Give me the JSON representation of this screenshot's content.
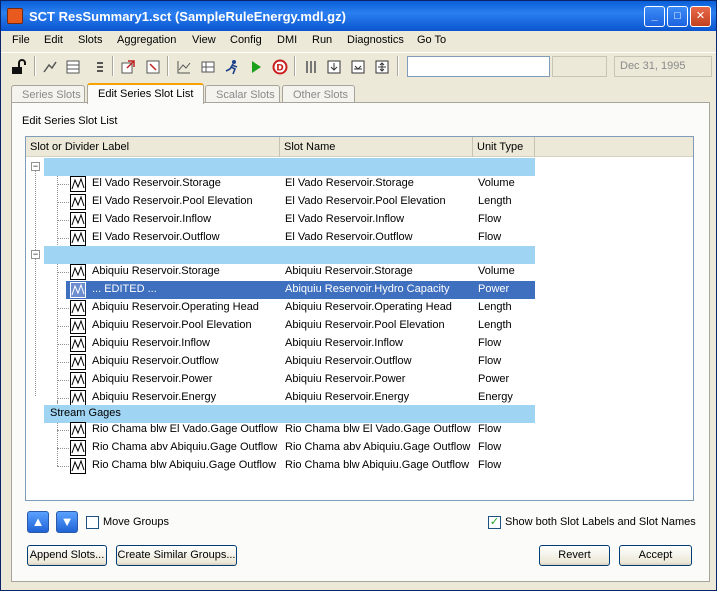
{
  "window": {
    "title": "SCT ResSummary1.sct (SampleRuleEnergy.mdl.gz)"
  },
  "menu": [
    "File",
    "Edit",
    "Slots",
    "Aggregation",
    "View",
    "Config",
    "DMI",
    "Run",
    "Diagnostics",
    "Go To"
  ],
  "toolbar": {
    "search_value": "",
    "date": "Dec 31, 1995"
  },
  "tabs": [
    {
      "label": "Series Slots",
      "active": false
    },
    {
      "label": "Edit Series Slot List",
      "active": true
    },
    {
      "label": "Scalar Slots",
      "active": false
    },
    {
      "label": "Other Slots",
      "active": false
    }
  ],
  "panel": {
    "heading": "Edit Series Slot List"
  },
  "table": {
    "columns": [
      "Slot or Divider Label",
      "Slot Name",
      "Unit Type"
    ],
    "rows": [
      {
        "kind": "divider",
        "label": ""
      },
      {
        "kind": "slot",
        "label": "El Vado Reservoir.Storage",
        "slot": "El Vado Reservoir.Storage",
        "unit": "Volume"
      },
      {
        "kind": "slot",
        "label": "El Vado Reservoir.Pool Elevation",
        "slot": "El Vado Reservoir.Pool Elevation",
        "unit": "Length"
      },
      {
        "kind": "slot",
        "label": "El Vado Reservoir.Inflow",
        "slot": "El Vado Reservoir.Inflow",
        "unit": "Flow"
      },
      {
        "kind": "slot",
        "label": "El Vado Reservoir.Outflow",
        "slot": "El Vado Reservoir.Outflow",
        "unit": "Flow"
      },
      {
        "kind": "divider",
        "label": ""
      },
      {
        "kind": "slot",
        "label": "Abiquiu Reservoir.Storage",
        "slot": "Abiquiu Reservoir.Storage",
        "unit": "Volume"
      },
      {
        "kind": "slot",
        "label": "... EDITED ...",
        "slot": "Abiquiu Reservoir.Hydro Capacity",
        "unit": "Power",
        "selected": true
      },
      {
        "kind": "slot",
        "label": "Abiquiu Reservoir.Operating Head",
        "slot": "Abiquiu Reservoir.Operating Head",
        "unit": "Length"
      },
      {
        "kind": "slot",
        "label": "Abiquiu Reservoir.Pool Elevation",
        "slot": "Abiquiu Reservoir.Pool Elevation",
        "unit": "Length"
      },
      {
        "kind": "slot",
        "label": "Abiquiu Reservoir.Inflow",
        "slot": "Abiquiu Reservoir.Inflow",
        "unit": "Flow"
      },
      {
        "kind": "slot",
        "label": "Abiquiu Reservoir.Outflow",
        "slot": "Abiquiu Reservoir.Outflow",
        "unit": "Flow"
      },
      {
        "kind": "slot",
        "label": "Abiquiu Reservoir.Power",
        "slot": "Abiquiu Reservoir.Power",
        "unit": "Power"
      },
      {
        "kind": "slot",
        "label": "Abiquiu Reservoir.Energy",
        "slot": "Abiquiu Reservoir.Energy",
        "unit": "Energy"
      },
      {
        "kind": "divider",
        "label": "Stream Gages"
      },
      {
        "kind": "slot",
        "label": "Rio Chama blw El Vado.Gage Outflow",
        "slot": "Rio Chama blw El Vado.Gage Outflow",
        "unit": "Flow"
      },
      {
        "kind": "slot",
        "label": "Rio Chama abv Abiquiu.Gage Outflow",
        "slot": "Rio Chama abv Abiquiu.Gage Outflow",
        "unit": "Flow"
      },
      {
        "kind": "slot",
        "label": "Rio Chama blw Abiquiu.Gage Outflow",
        "slot": "Rio Chama blw Abiquiu.Gage Outflow",
        "unit": "Flow"
      }
    ]
  },
  "controls": {
    "move_groups_label": "Move Groups",
    "move_groups_checked": false,
    "show_both_label": "Show both Slot Labels and Slot Names",
    "show_both_checked": true,
    "append_slots": "Append Slots...",
    "create_similar_groups": "Create Similar Groups...",
    "revert": "Revert",
    "accept": "Accept"
  }
}
